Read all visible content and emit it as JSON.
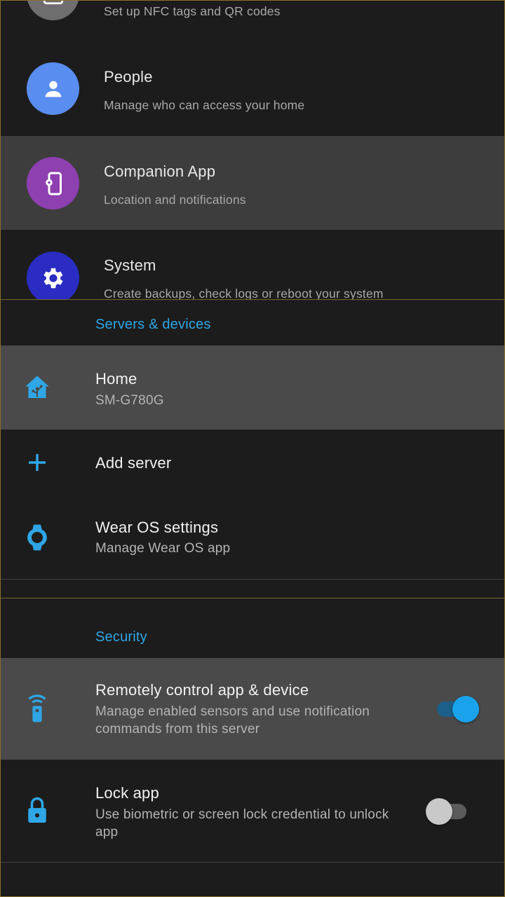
{
  "config_list": {
    "items": [
      {
        "title": "",
        "subtitle": "Set up NFC tags and QR codes",
        "icon": "nfc-tag-icon",
        "color": "#6e6e6e"
      },
      {
        "title": "People",
        "subtitle": "Manage who can access your home",
        "icon": "person-icon",
        "color": "#5a8df0"
      },
      {
        "title": "Companion App",
        "subtitle": "Location and notifications",
        "icon": "cellphone-cog-icon",
        "color": "#8e3fb0"
      },
      {
        "title": "System",
        "subtitle": "Create backups, check logs or reboot your system",
        "icon": "gear-icon",
        "color": "#2a2cc2"
      }
    ]
  },
  "servers_section": {
    "title": "Servers & devices",
    "items": [
      {
        "title": "Home",
        "subtitle": "SM-G780G",
        "icon": "home-assistant-icon"
      },
      {
        "title": "Add server",
        "subtitle": "",
        "icon": "plus-icon"
      },
      {
        "title": "Wear OS settings",
        "subtitle": "Manage Wear OS app",
        "icon": "watch-icon"
      }
    ]
  },
  "security_section": {
    "title": "Security",
    "items": [
      {
        "title": "Remotely control app & device",
        "subtitle": "Manage enabled sensors and use notification commands from this server",
        "icon": "remote-icon",
        "toggle_on": true
      },
      {
        "title": "Lock app",
        "subtitle": "Use biometric or screen lock credential to unlock app",
        "icon": "lock-icon",
        "toggle_on": false
      }
    ]
  },
  "colors": {
    "accent": "#2fa6e6",
    "background": "#1c1c1c",
    "highlight": "#4a4a4a"
  }
}
